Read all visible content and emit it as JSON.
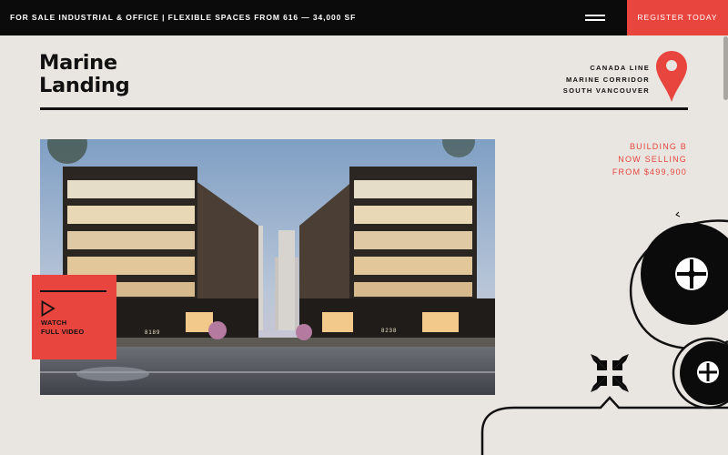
{
  "topbar": {
    "announcement": "FOR SALE INDUSTRIAL & OFFICE  |  FLEXIBLE SPACES FROM 616 — 34,000 SF",
    "register_label": "REGISTER TODAY"
  },
  "logo": {
    "line1": "Marine",
    "line2": "Landing"
  },
  "location": {
    "line1": "CANADA LINE",
    "line2": "MARINE CORRIDOR",
    "line3": "SOUTH VANCOUVER"
  },
  "promo": {
    "line1": "BUILDING B",
    "line2": "NOW SELLING",
    "line3": "FROM $499,900"
  },
  "video": {
    "line1": "WATCH",
    "line2": "FULL VIDEO"
  },
  "hero": {
    "building_number_left": "8189",
    "building_number_right": "8238"
  },
  "colors": {
    "accent": "#e8453f",
    "ink": "#111111",
    "background": "#e9e6e1",
    "topbar": "#0b0b0b"
  },
  "icons": [
    "menu-icon",
    "map-pin-icon",
    "play-icon",
    "collapse-arrows-icon",
    "reel-icon"
  ]
}
